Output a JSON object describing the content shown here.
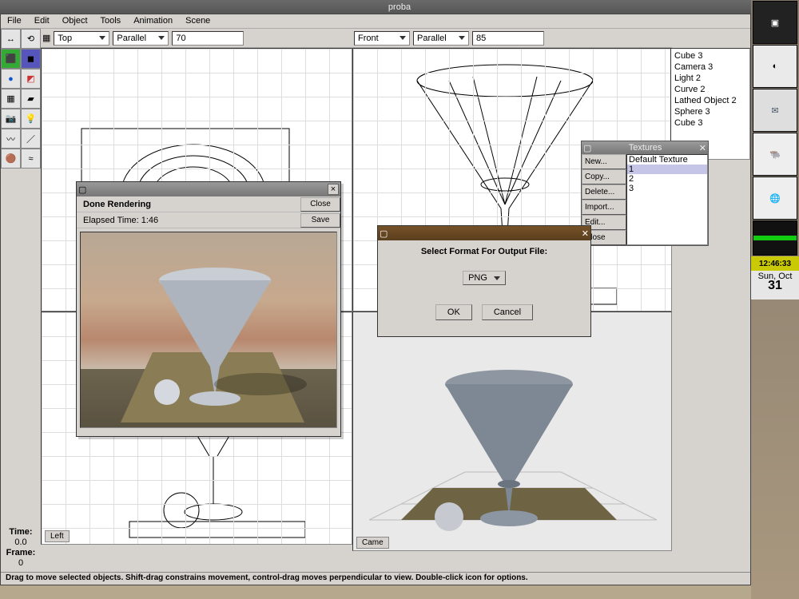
{
  "window": {
    "title": "proba"
  },
  "menu": [
    "File",
    "Edit",
    "Object",
    "Tools",
    "Animation",
    "Scene"
  ],
  "views": {
    "top": {
      "name": "Top",
      "proj": "Parallel",
      "zoom": "70"
    },
    "front": {
      "name": "Front",
      "proj": "Parallel",
      "zoom": "85"
    },
    "left": {
      "label": "Left"
    },
    "cam": {
      "label": "Came"
    }
  },
  "scene_objects": [
    "Cube 3",
    "Camera 3",
    "Light 2",
    "Curve 2",
    "Lathed Object 2",
    "Sphere 3",
    "Cube 3"
  ],
  "textures": {
    "title": "Textures",
    "buttons": [
      "New...",
      "Copy...",
      "Delete...",
      "Import...",
      "Edit...",
      "Close"
    ],
    "items": [
      "Default Texture",
      "1",
      "2",
      "3"
    ]
  },
  "render": {
    "done": "Done Rendering",
    "close": "Close",
    "elapsed": "Elapsed Time: 1:46",
    "save": "Save"
  },
  "format": {
    "label": "Select Format For Output File:",
    "value": "PNG",
    "ok": "OK",
    "cancel": "Cancel"
  },
  "status": {
    "time_lbl": "Time:",
    "time": "0.0",
    "frame_lbl": "Frame:",
    "frame": "0"
  },
  "statusbar": "Drag to move selected objects.  Shift-drag constrains movement, control-drag moves perpendicular to view.  Double-click icon for options.",
  "clock": {
    "time": "12:46:33",
    "day": "Sun, Oct",
    "date": "31"
  }
}
